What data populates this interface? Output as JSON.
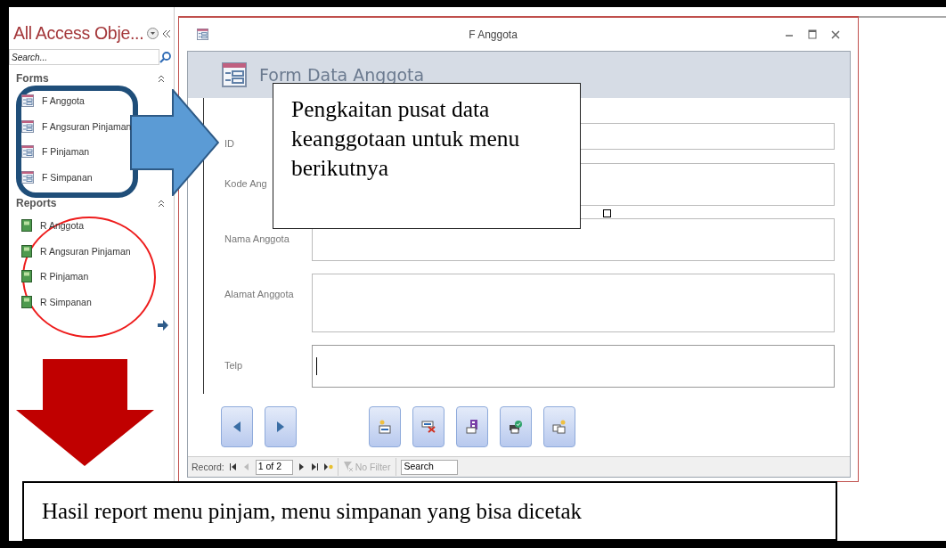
{
  "nav_pane": {
    "title": "All Access Obje...",
    "search": {
      "placeholder": "Search..."
    },
    "groups": [
      {
        "label": "Forms",
        "kind": "form",
        "items": [
          "F Anggota",
          "F Angsuran Pinjaman",
          "F Pinjaman",
          "F Simpanan"
        ]
      },
      {
        "label": "Reports",
        "kind": "report",
        "items": [
          "R Anggota",
          "R Angsuran Pinjaman",
          "R Pinjaman",
          "R Simpanan"
        ]
      }
    ]
  },
  "form_window": {
    "title": "F Anggota",
    "header": "Form Data Anggota",
    "fields": [
      {
        "label": "ID",
        "focused": false
      },
      {
        "label": "Kode Ang",
        "focused": false
      },
      {
        "label": "Nama Anggota",
        "focused": false
      },
      {
        "label": "Alamat Anggota",
        "focused": false
      },
      {
        "label": "Telp",
        "focused": true
      }
    ],
    "buttons": [
      {
        "kind": "previous"
      },
      {
        "kind": "next"
      },
      {
        "kind": "new"
      },
      {
        "kind": "delete"
      },
      {
        "kind": "save"
      },
      {
        "kind": "print"
      },
      {
        "kind": "duplicate"
      }
    ],
    "record_bar": {
      "label": "Record:",
      "position": "1 of 2",
      "filter": "No Filter",
      "search": "Search"
    }
  },
  "annotations": {
    "callout": "Pengkaitan pusat data keanggotaan untuk menu berikutnya",
    "caption": "Hasil report menu pinjam, menu simpanan yang bisa dicetak"
  }
}
